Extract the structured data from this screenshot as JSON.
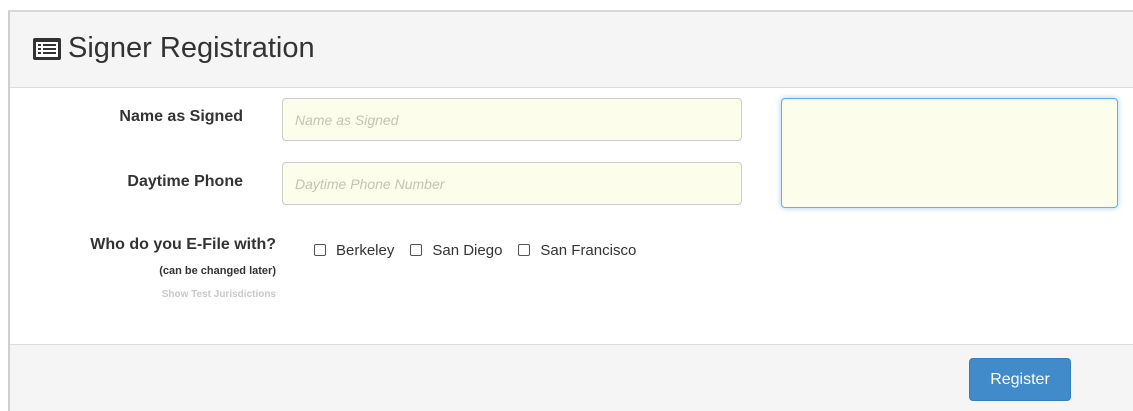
{
  "header": {
    "title": "Signer Registration",
    "icon": "list-alt-icon"
  },
  "form": {
    "name_label": "Name as Signed",
    "name_placeholder": "Name as Signed",
    "name_value": "",
    "phone_label": "Daytime Phone",
    "phone_placeholder": "Daytime Phone Number",
    "phone_value": "",
    "efile_label": "Who do you E-File with?",
    "efile_note": "(can be changed later)",
    "test_jurisdictions_link": "Show Test Jurisdictions",
    "jurisdictions": [
      {
        "label": "Berkeley",
        "checked": false
      },
      {
        "label": "San Diego",
        "checked": false
      },
      {
        "label": "San Francisco",
        "checked": false
      }
    ]
  },
  "footer": {
    "register_label": "Register"
  },
  "colors": {
    "input_bg": "#fcfdeb",
    "primary": "#428bca",
    "panel_bg": "#f5f5f5"
  }
}
